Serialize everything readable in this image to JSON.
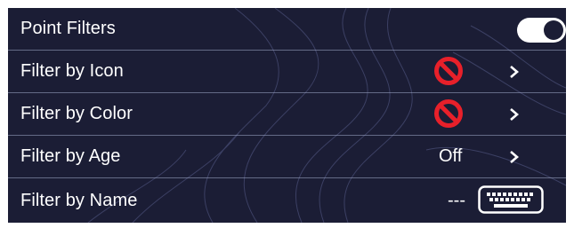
{
  "colors": {
    "background": "#1b1d35",
    "text": "#ffffff",
    "prohibited": "#e8202a"
  },
  "rows": [
    {
      "label": "Point Filters",
      "control": "toggle",
      "state": "on"
    },
    {
      "label": "Filter by Icon",
      "control": "prohibited-icon"
    },
    {
      "label": "Filter by Color",
      "control": "prohibited-icon"
    },
    {
      "label": "Filter by Age",
      "value": "Off"
    },
    {
      "label": "Filter by Name",
      "value": "---",
      "control": "keyboard-icon"
    }
  ]
}
